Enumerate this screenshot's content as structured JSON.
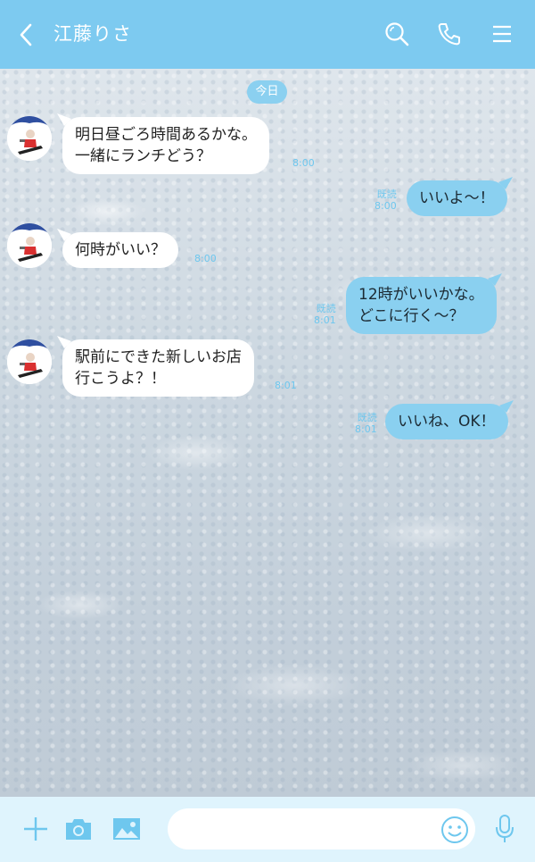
{
  "header": {
    "title": "江藤りさ",
    "icons": [
      "back-arrow-icon",
      "search-icon",
      "phone-icon",
      "menu-icon"
    ],
    "bg_color": "#7dcaf0"
  },
  "date_label": "今日",
  "messages": [
    {
      "direction": "in",
      "lines": [
        "明日昼ごろ時間あるかな。",
        "一緒にランチどう？"
      ],
      "time": "8:00"
    },
    {
      "direction": "out",
      "lines": [
        "いいよ〜！"
      ],
      "read": "既読",
      "time": "8:00"
    },
    {
      "direction": "in",
      "lines": [
        "何時がいい？"
      ],
      "time": "8:00"
    },
    {
      "direction": "out",
      "lines": [
        "12時がいいかな。",
        "どこに行く〜？"
      ],
      "read": "既読",
      "time": "8:01"
    },
    {
      "direction": "in",
      "lines": [
        "駅前にできた新しいお店",
        "行こうよ？！"
      ],
      "time": "8:01"
    },
    {
      "direction": "out",
      "lines": [
        "いいね、OK！"
      ],
      "read": "既読",
      "time": "8:01"
    }
  ],
  "footer": {
    "input_placeholder": "",
    "icons": [
      "add-icon",
      "camera-icon",
      "image-icon",
      "emoji-icon",
      "mic-icon"
    ],
    "bg_color": "#dff4fd"
  },
  "colors": {
    "accent": "#7dcaf0",
    "outgoing_bubble": "#8ad0f0",
    "incoming_bubble": "#ffffff",
    "meta_text": "#6ec7ee"
  }
}
